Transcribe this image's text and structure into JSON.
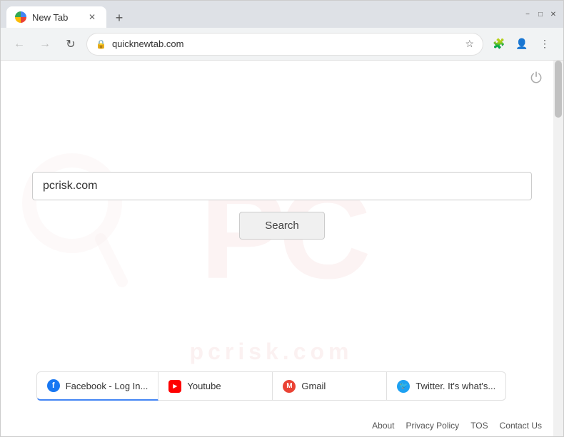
{
  "browser": {
    "tab_title": "New Tab",
    "url": "quicknewtab.com",
    "new_tab_icon": "+",
    "back_label": "←",
    "forward_label": "→",
    "reload_label": "↻"
  },
  "page": {
    "power_icon": "⏻",
    "watermark_text": "PC",
    "watermark_bottom_text": "pcrisk.com",
    "search_placeholder": "",
    "search_value": "pcrisk.com",
    "search_button_label": "Search"
  },
  "quick_links": [
    {
      "label": "Facebook - Log In...",
      "icon_type": "facebook"
    },
    {
      "label": "Youtube",
      "icon_type": "youtube"
    },
    {
      "label": "Gmail",
      "icon_type": "gmail"
    },
    {
      "label": "Twitter. It's what's...",
      "icon_type": "twitter"
    }
  ],
  "footer": {
    "about": "About",
    "privacy_policy": "Privacy Policy",
    "tos": "TOS",
    "contact_us": "Contact Us"
  },
  "window_controls": {
    "minimize": "−",
    "maximize": "□",
    "close": "✕"
  }
}
